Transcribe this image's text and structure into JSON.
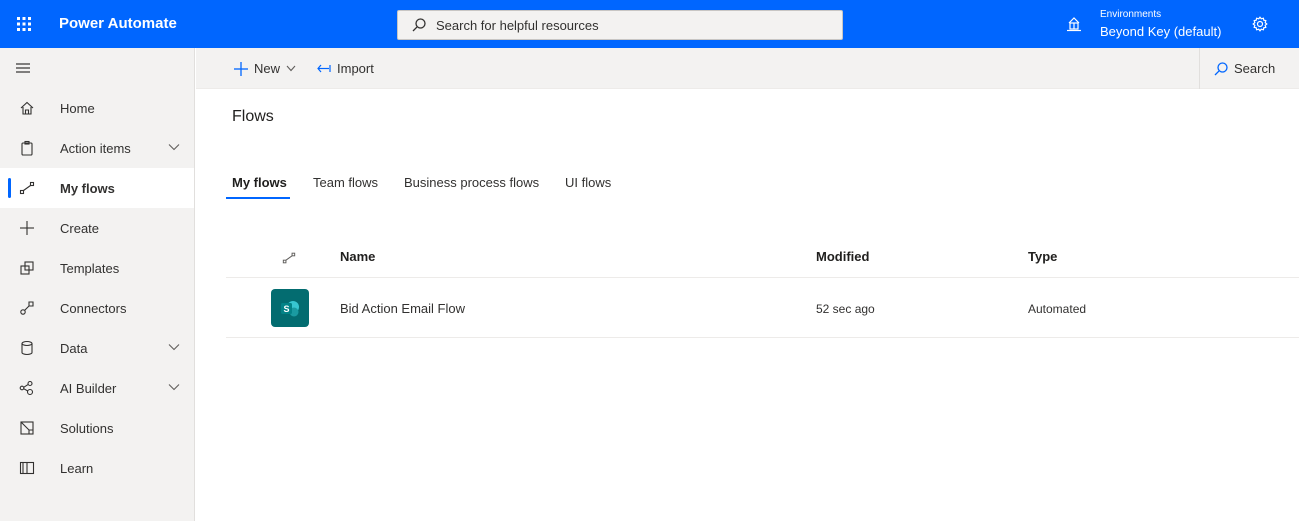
{
  "topbar": {
    "app_title": "Power Automate",
    "search_placeholder": "Search for helpful resources",
    "environment_label": "Environments",
    "environment_name": "Beyond Key (default)",
    "bg_color": "#0066ff"
  },
  "sidebar": {
    "items": [
      {
        "label": "Home",
        "icon": "home-icon"
      },
      {
        "label": "Action items",
        "icon": "clipboard-icon",
        "expandable": true
      },
      {
        "label": "My flows",
        "icon": "flow-icon",
        "active": true
      },
      {
        "label": "Create",
        "icon": "plus-icon"
      },
      {
        "label": "Templates",
        "icon": "templates-icon"
      },
      {
        "label": "Connectors",
        "icon": "connector-icon"
      },
      {
        "label": "Data",
        "icon": "database-icon",
        "expandable": true
      },
      {
        "label": "AI Builder",
        "icon": "ai-builder-icon",
        "expandable": true
      },
      {
        "label": "Solutions",
        "icon": "solutions-icon"
      },
      {
        "label": "Learn",
        "icon": "book-icon"
      }
    ]
  },
  "commandbar": {
    "new_label": "New",
    "import_label": "Import",
    "search_label": "Search"
  },
  "main": {
    "title": "Flows",
    "tabs": [
      {
        "label": "My flows",
        "active": true
      },
      {
        "label": "Team flows"
      },
      {
        "label": "Business process flows"
      },
      {
        "label": "UI flows"
      }
    ],
    "table": {
      "columns": [
        "Name",
        "Modified",
        "Type"
      ],
      "rows": [
        {
          "name": "Bid Action Email Flow",
          "modified": "52 sec ago",
          "type": "Automated",
          "icon": "sharepoint-icon",
          "icon_color": "#036c70"
        }
      ]
    }
  }
}
